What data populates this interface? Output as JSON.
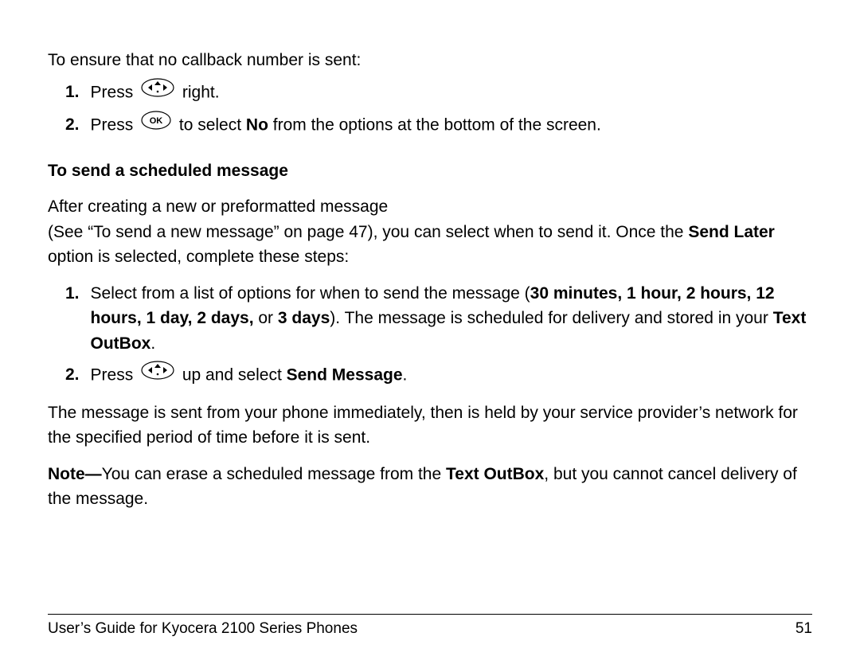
{
  "intro": "To ensure that no callback number is sent:",
  "list1": {
    "item1": {
      "num": "1.",
      "before": "Press ",
      "after": " right."
    },
    "item2": {
      "num": "2.",
      "before": "Press ",
      "mid1": " to select ",
      "bold1": "No",
      "after": " from the options at the bottom of the screen."
    }
  },
  "heading1": "To send a scheduled message",
  "para1": {
    "line1": "After creating a new or preformatted message",
    "line2a": "(See “To send a new message” on page 47), you can select when to send it. Once the ",
    "bold1": "Send Later",
    "line2b": " option is selected, complete these steps:"
  },
  "list2": {
    "item1": {
      "num": "1.",
      "a": "Select from a list of options for when to send the message (",
      "bold1": "30 minutes, 1 hour, 2 hours, 12 hours, 1 day, 2 days,",
      "b": " or ",
      "bold2": "3 days",
      "c": "). The message is scheduled for delivery and stored in your ",
      "bold3": "Text OutBox",
      "d": "."
    },
    "item2": {
      "num": "2.",
      "a": "Press ",
      "b": " up and select ",
      "bold1": "Send Message",
      "c": "."
    }
  },
  "para2": "The message is sent from your phone immediately, then is held by your service provider’s network for the specified period of time before it is sent.",
  "note": {
    "bold1": "Note—",
    "a": "You can erase a scheduled message from the ",
    "bold2": "Text OutBox",
    "b": ", but you cannot cancel delivery of the message."
  },
  "footer": {
    "title": "User’s Guide for Kyocera 2100 Series Phones",
    "page": "51"
  }
}
